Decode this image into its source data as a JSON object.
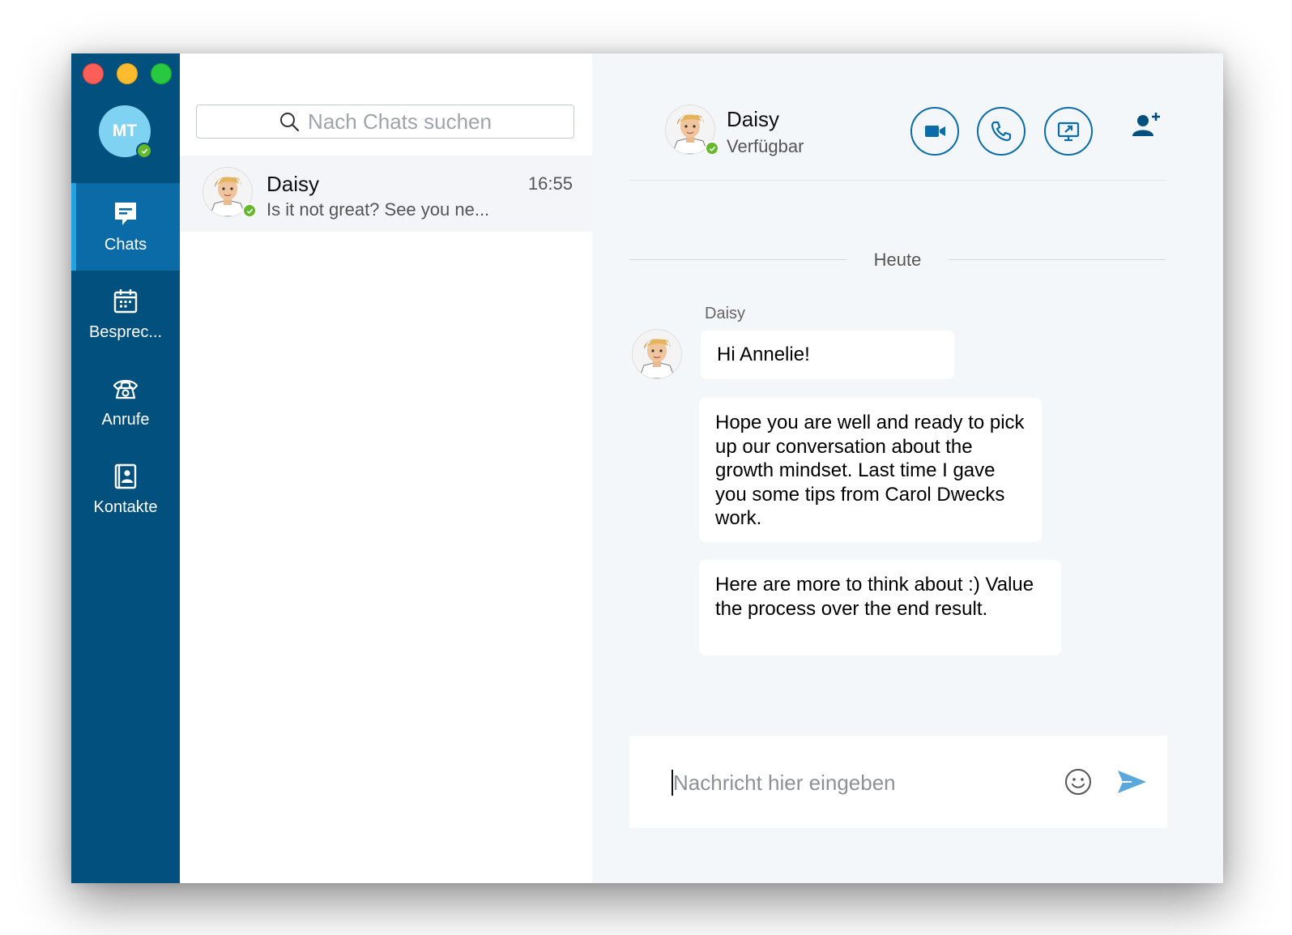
{
  "window": {
    "traffic_lights": [
      "close",
      "minimize",
      "maximize"
    ]
  },
  "profile": {
    "initials": "MT",
    "status_color": "#63b92b"
  },
  "nav": {
    "items": [
      {
        "label": "Chats",
        "icon": "chat-bubble-icon",
        "active": true
      },
      {
        "label": "Besprec...",
        "icon": "calendar-icon",
        "active": false
      },
      {
        "label": "Anrufe",
        "icon": "phone-icon",
        "active": false
      },
      {
        "label": "Kontakte",
        "icon": "contacts-icon",
        "active": false
      }
    ]
  },
  "search": {
    "placeholder": "Nach Chats suchen"
  },
  "chat_list": [
    {
      "name": "Daisy",
      "time": "16:55",
      "preview": "Is it not great? See you ne...",
      "status": "available"
    }
  ],
  "conversation": {
    "contact_name": "Daisy",
    "contact_status": "Verfügbar",
    "actions": [
      "video-call",
      "audio-call",
      "share-screen",
      "add-person"
    ],
    "day_separator": "Heute",
    "sender": "Daisy",
    "messages": [
      "Hi Annelie!",
      "Hope you are well and ready to pick up our conversation about the growth mindset. Last time I gave you some tips from Carol Dwecks work.",
      "Here are  more to think about :) Value the process over the end result."
    ]
  },
  "composer": {
    "placeholder": "Nachricht hier eingeben"
  },
  "colors": {
    "rail": "#02507e",
    "rail_active": "#0a6ba7",
    "accent": "#0b6ca7",
    "status_available": "#63b92b",
    "send": "#5aa7dc"
  }
}
